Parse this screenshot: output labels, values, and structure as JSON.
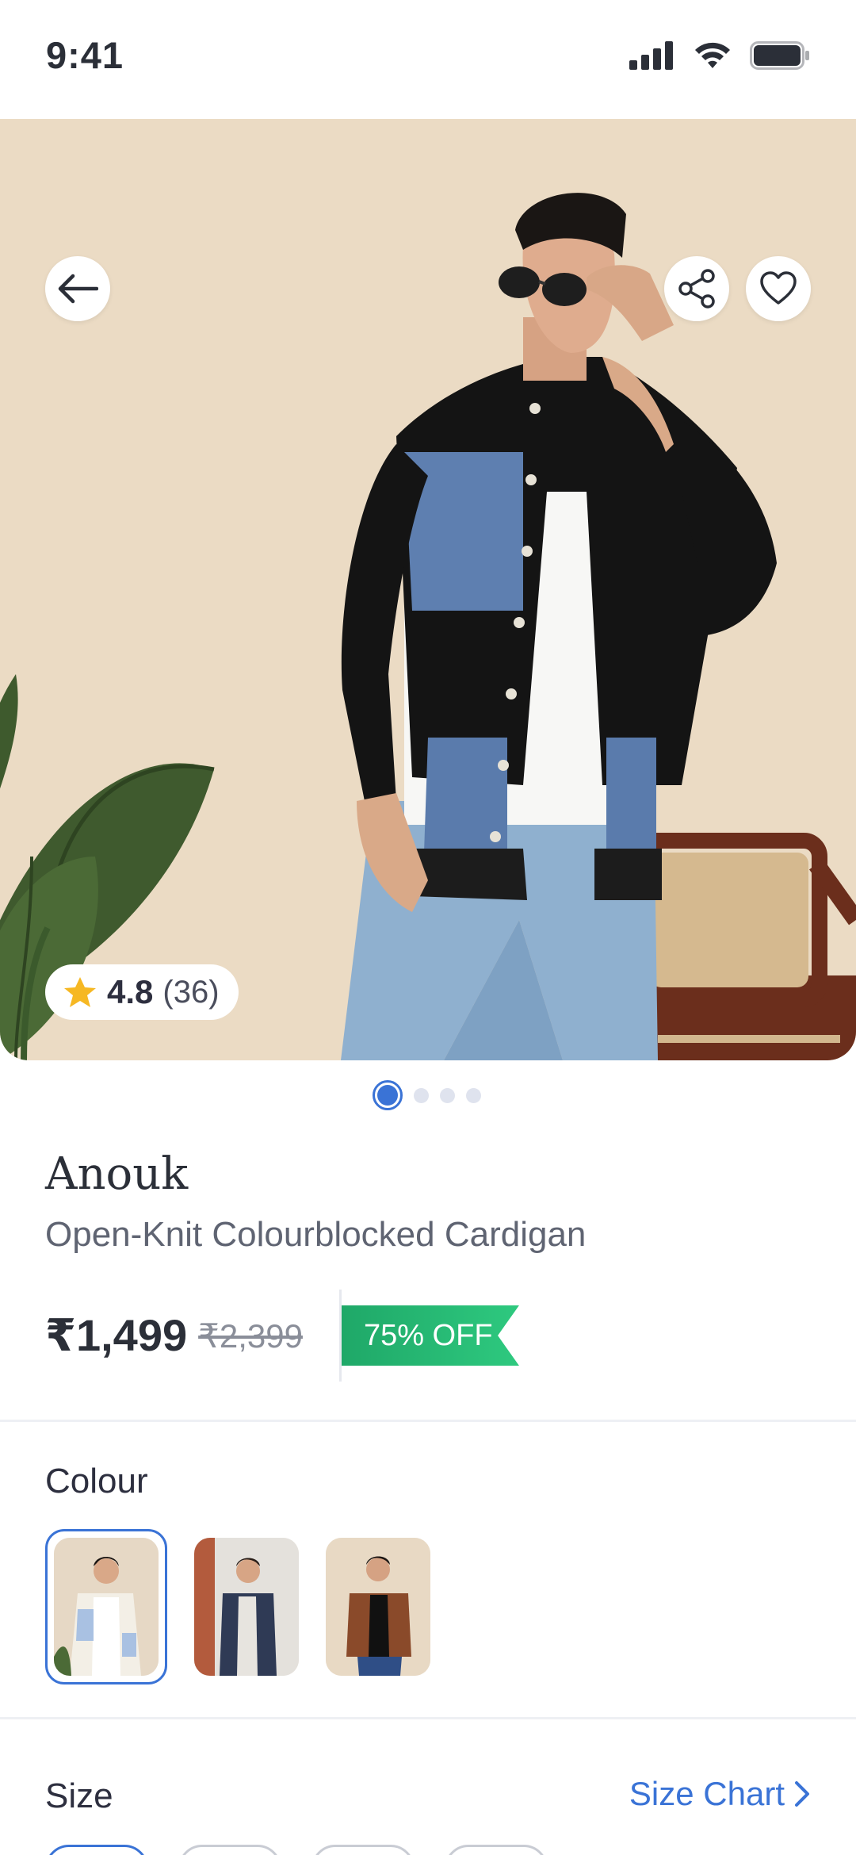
{
  "status_bar": {
    "time": "9:41"
  },
  "product": {
    "brand": "Anouk",
    "name": "Open-Knit Colourblocked Cardigan",
    "price": "₹1,499",
    "mrp": "₹2,399",
    "discount": "75% OFF",
    "rating": "4.8",
    "rating_count": "(36)"
  },
  "gallery": {
    "image_count": 4,
    "active_index": 0
  },
  "colour": {
    "title": "Colour",
    "options": [
      "cream-blue colourblock",
      "navy cardigan",
      "brown jacket"
    ],
    "selected_index": 0
  },
  "size": {
    "title": "Size",
    "chart_link": "Size Chart"
  },
  "colors": {
    "accent": "#3a73d6",
    "discount": "#22b06f",
    "text": "#2d2f3f"
  }
}
